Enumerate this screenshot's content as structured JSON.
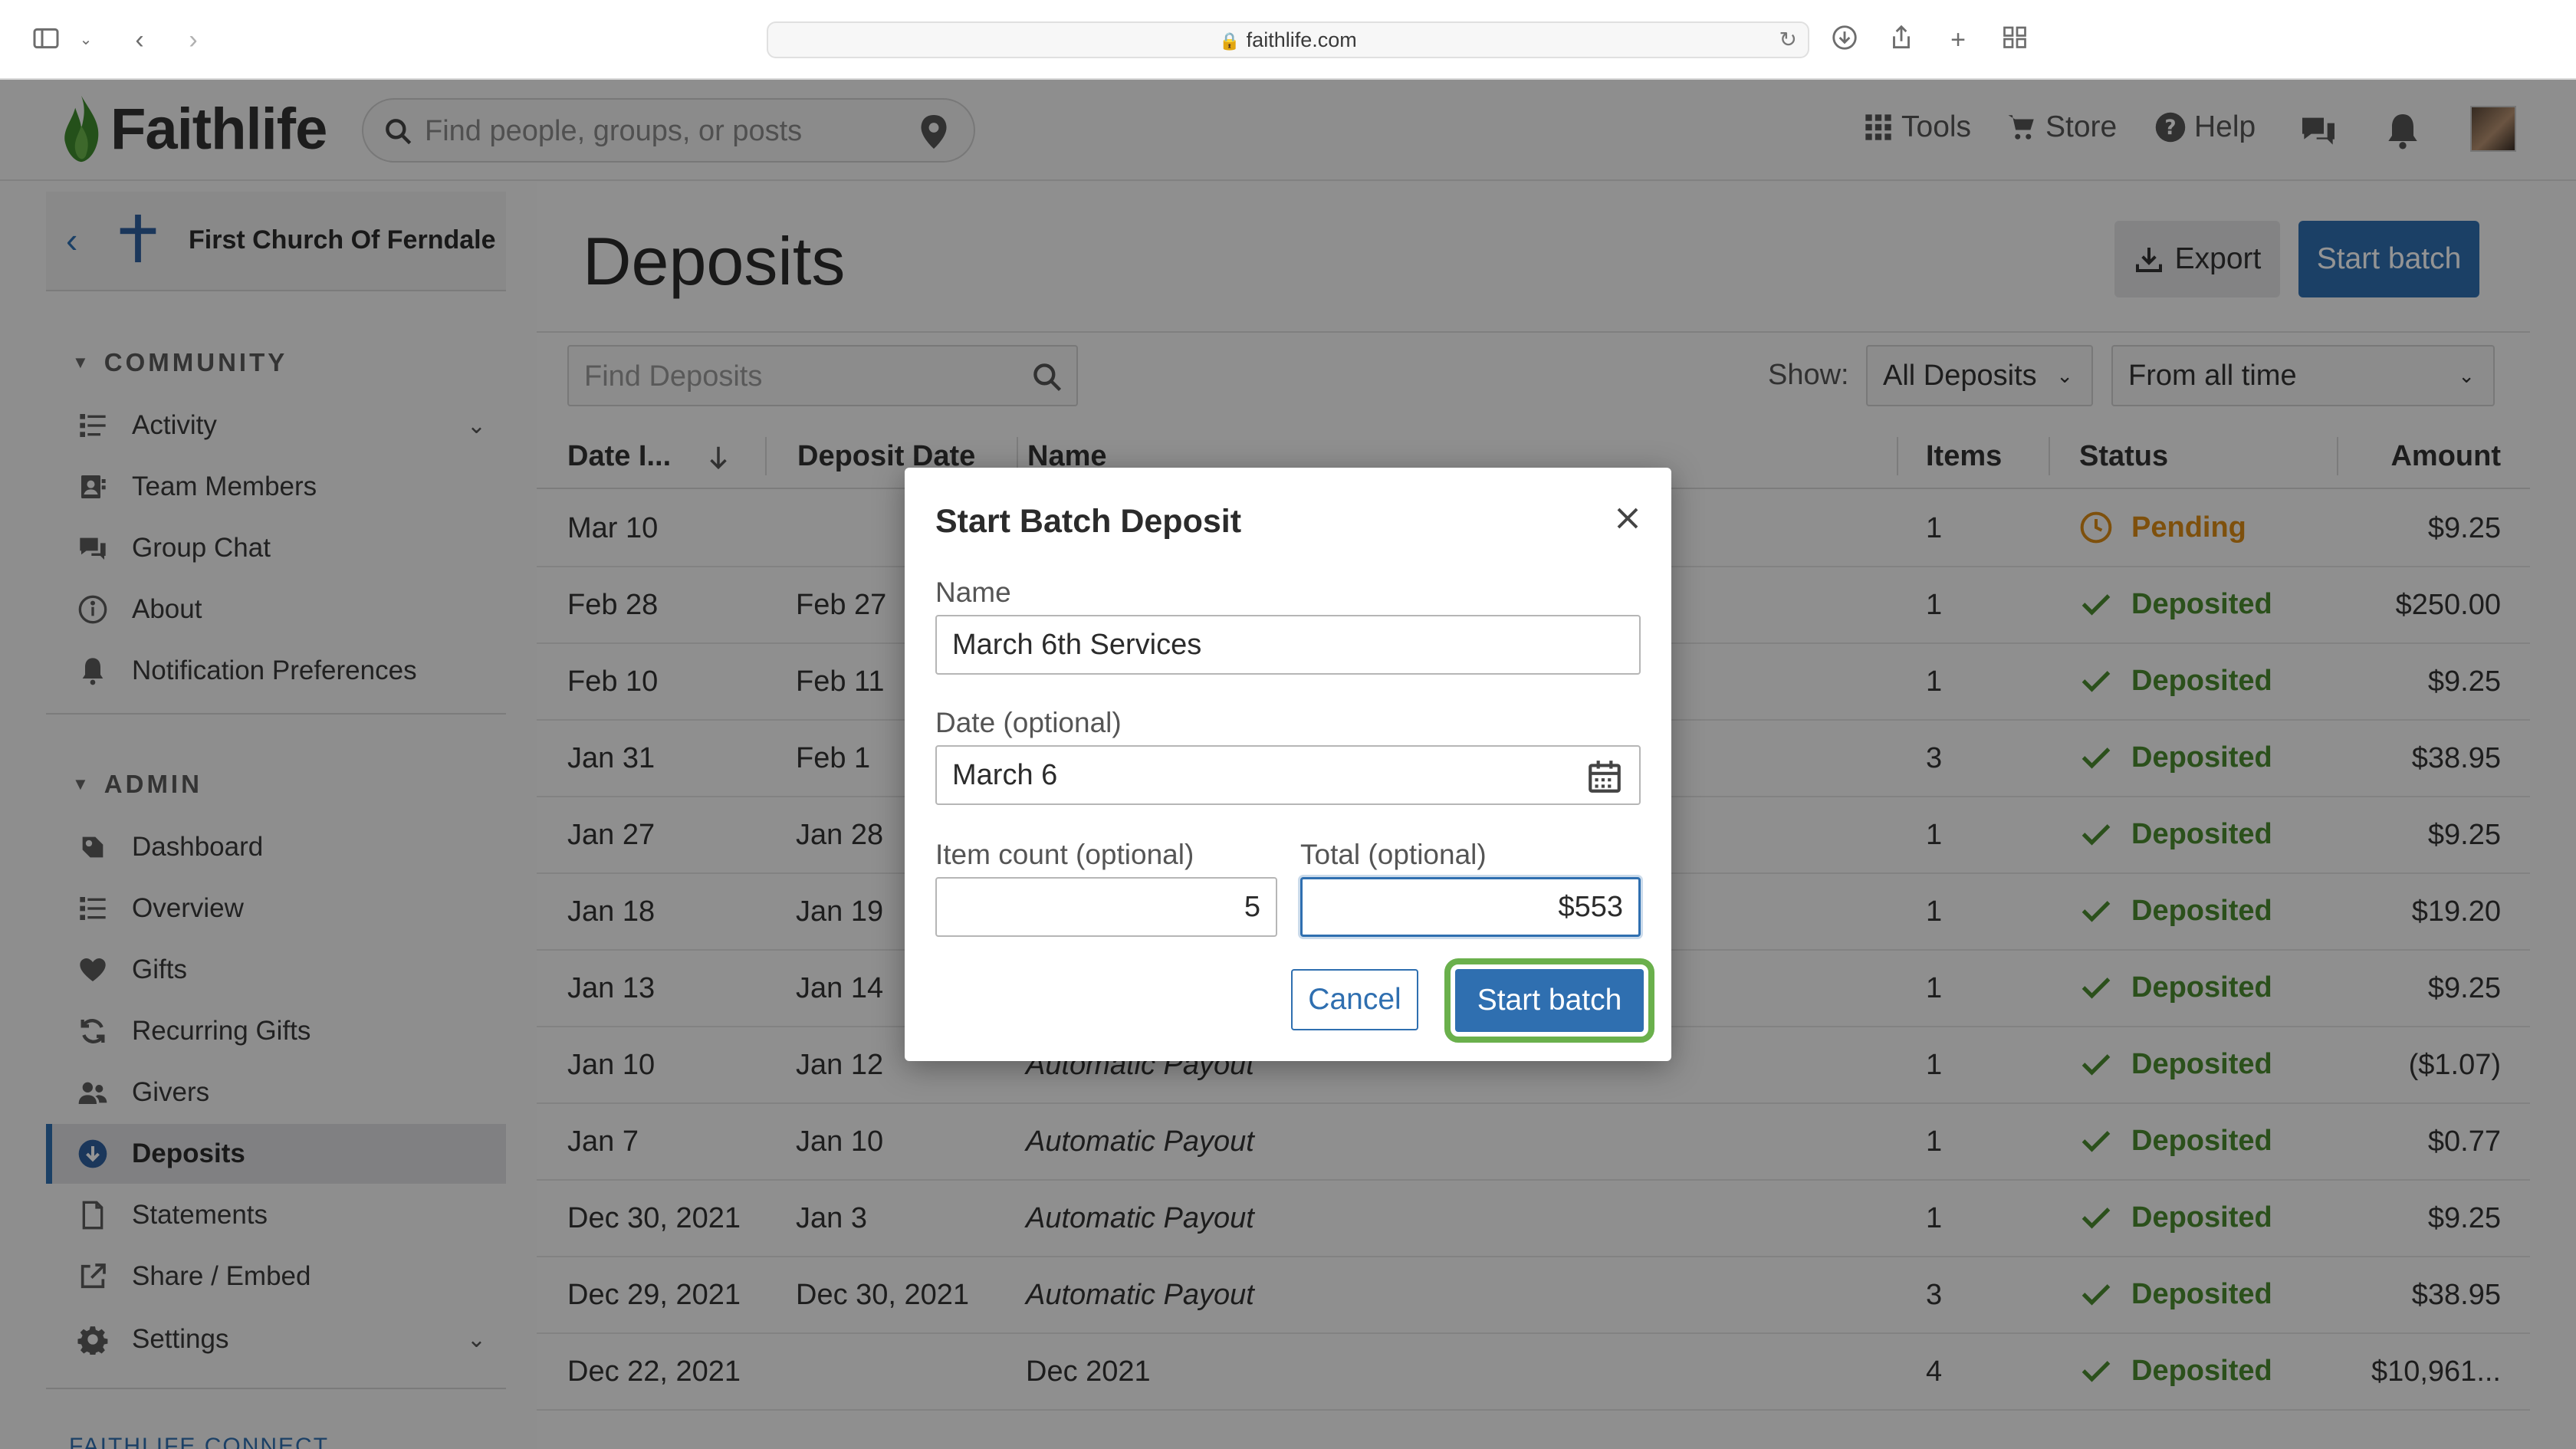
{
  "browser": {
    "url": "faithlife.com"
  },
  "header": {
    "brand": "Faithlife",
    "search_placeholder": "Find people, groups, or posts",
    "nav": {
      "tools": "Tools",
      "store": "Store",
      "help": "Help"
    }
  },
  "sidebar": {
    "church_name": "First Church Of Ferndale",
    "community_title": "COMMUNITY",
    "community_items": [
      {
        "label": "Activity",
        "icon": "activity-icon"
      },
      {
        "label": "Team Members",
        "icon": "team-members-icon"
      },
      {
        "label": "Group Chat",
        "icon": "chat-icon"
      },
      {
        "label": "About",
        "icon": "info-icon"
      },
      {
        "label": "Notification Preferences",
        "icon": "bell-icon"
      }
    ],
    "admin_title": "ADMIN",
    "admin_items": [
      {
        "label": "Dashboard",
        "icon": "dashboard-icon"
      },
      {
        "label": "Overview",
        "icon": "overview-icon"
      },
      {
        "label": "Gifts",
        "icon": "heart-icon"
      },
      {
        "label": "Recurring Gifts",
        "icon": "recurring-icon"
      },
      {
        "label": "Givers",
        "icon": "givers-icon"
      },
      {
        "label": "Deposits",
        "icon": "deposits-icon",
        "active": true
      },
      {
        "label": "Statements",
        "icon": "document-icon"
      },
      {
        "label": "Share / Embed",
        "icon": "share-icon"
      },
      {
        "label": "Settings",
        "icon": "gear-icon"
      }
    ],
    "connect_label": "FAITHLIFE CONNECT"
  },
  "main": {
    "title": "Deposits",
    "export_label": "Export",
    "start_batch_label": "Start batch",
    "find_placeholder": "Find Deposits",
    "show_label": "Show:",
    "filter_value": "All Deposits",
    "time_value": "From all time",
    "columns": {
      "date_initiated": "Date I...",
      "deposit_date": "Deposit Date",
      "name": "Name",
      "items": "Items",
      "status": "Status",
      "amount": "Amount"
    },
    "rows": [
      {
        "date": "Mar 10",
        "deposit_date": "",
        "name": "",
        "items": "1",
        "status": "Pending",
        "amount": "$9.25"
      },
      {
        "date": "Feb 28",
        "deposit_date": "Feb 27",
        "name": "",
        "items": "1",
        "status": "Deposited",
        "amount": "$250.00"
      },
      {
        "date": "Feb 10",
        "deposit_date": "Feb 11",
        "name": "",
        "items": "1",
        "status": "Deposited",
        "amount": "$9.25"
      },
      {
        "date": "Jan 31",
        "deposit_date": "Feb 1",
        "name": "",
        "items": "3",
        "status": "Deposited",
        "amount": "$38.95"
      },
      {
        "date": "Jan 27",
        "deposit_date": "Jan 28",
        "name": "",
        "items": "1",
        "status": "Deposited",
        "amount": "$9.25"
      },
      {
        "date": "Jan 18",
        "deposit_date": "Jan 19",
        "name": "",
        "items": "1",
        "status": "Deposited",
        "amount": "$19.20"
      },
      {
        "date": "Jan 13",
        "deposit_date": "Jan 14",
        "name": "",
        "items": "1",
        "status": "Deposited",
        "amount": "$9.25"
      },
      {
        "date": "Jan 10",
        "deposit_date": "Jan 12",
        "name": "Automatic Payout",
        "items": "1",
        "status": "Deposited",
        "amount": "($1.07)"
      },
      {
        "date": "Jan 7",
        "deposit_date": "Jan 10",
        "name": "Automatic Payout",
        "items": "1",
        "status": "Deposited",
        "amount": "$0.77"
      },
      {
        "date": "Dec 30, 2021",
        "deposit_date": "Jan 3",
        "name": "Automatic Payout",
        "items": "1",
        "status": "Deposited",
        "amount": "$9.25"
      },
      {
        "date": "Dec 29, 2021",
        "deposit_date": "Dec 30, 2021",
        "name": "Automatic Payout",
        "items": "3",
        "status": "Deposited",
        "amount": "$38.95"
      },
      {
        "date": "Dec 22, 2021",
        "deposit_date": "",
        "name": "Dec 2021",
        "items": "4",
        "status": "Deposited",
        "amount": "$10,961..."
      }
    ]
  },
  "dialog": {
    "title": "Start Batch Deposit",
    "name_label": "Name",
    "name_value": "March 6th Services",
    "date_label": "Date (optional)",
    "date_value": "March 6",
    "item_count_label": "Item count (optional)",
    "item_count_value": "5",
    "total_label": "Total (optional)",
    "total_value": "$553",
    "cancel_label": "Cancel",
    "start_label": "Start batch"
  },
  "colors": {
    "accent": "#2f6fb0",
    "deposited": "#4a8a2f",
    "pending": "#d98b15",
    "highlight_ring": "#6ab04c"
  }
}
